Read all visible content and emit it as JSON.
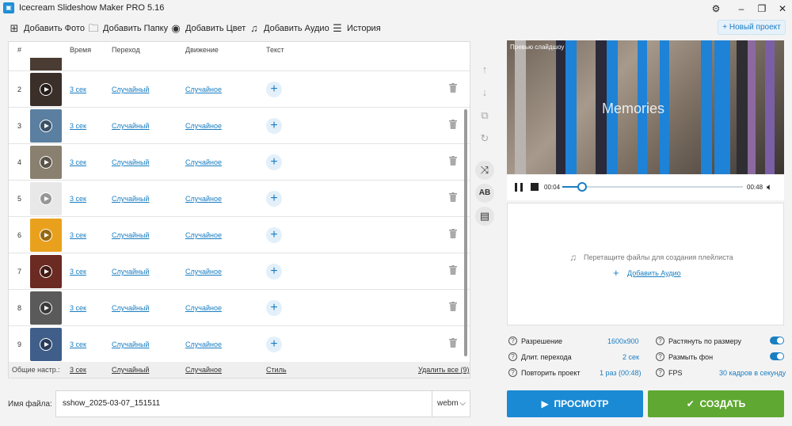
{
  "window": {
    "title": "Icecream Slideshow Maker PRO 5.16"
  },
  "toolbar": {
    "add_photo": "Добавить Фото",
    "add_folder": "Добавить Папку",
    "add_color": "Добавить Цвет",
    "add_audio": "Добавить Аудио",
    "history": "История",
    "new_project": "+ Новый проект"
  },
  "list": {
    "headers": {
      "num": "#",
      "time": "Время",
      "transition": "Переход",
      "motion": "Движение",
      "text": "Текст"
    },
    "rows": [
      {
        "num": "2",
        "time": "3 сек",
        "transition": "Случайный",
        "motion": "Случайное",
        "thumb_color": "#3b2f2a"
      },
      {
        "num": "3",
        "time": "3 сек",
        "transition": "Случайный",
        "motion": "Случайное",
        "thumb_color": "#5b7fa0"
      },
      {
        "num": "4",
        "time": "3 сек",
        "transition": "Случайный",
        "motion": "Случайное",
        "thumb_color": "#8a8070"
      },
      {
        "num": "5",
        "time": "3 сек",
        "transition": "Случайный",
        "motion": "Случайное",
        "thumb_color": "#e8e8e8"
      },
      {
        "num": "6",
        "time": "3 сек",
        "transition": "Случайный",
        "motion": "Случайное",
        "thumb_color": "#e9a11d"
      },
      {
        "num": "7",
        "time": "3 сек",
        "transition": "Случайный",
        "motion": "Случайное",
        "thumb_color": "#6b2a22"
      },
      {
        "num": "8",
        "time": "3 сек",
        "transition": "Случайный",
        "motion": "Случайное",
        "thumb_color": "#5a5a5a"
      },
      {
        "num": "9",
        "time": "3 сек",
        "transition": "Случайный",
        "motion": "Случайное",
        "thumb_color": "#3f5f8a"
      }
    ],
    "footer": {
      "label": "Общие настр.:",
      "time": "3 сек",
      "transition": "Случайный",
      "motion": "Случайное",
      "style": "Стиль",
      "delete_all": "Удалить все (9)"
    }
  },
  "filename": {
    "label": "Имя файла:",
    "value": "sshow_2025-03-07_151511",
    "format": "webm"
  },
  "preview": {
    "label": "Превью слайдшоу",
    "caption": "Memories",
    "current_time": "00:04",
    "total_time": "00:48",
    "progress": 0.11
  },
  "audio": {
    "drop_hint": "Перетащите файлы для создания плейлиста",
    "add_audio": "Добавить Аудио"
  },
  "settings": {
    "resolution_label": "Разрешение",
    "resolution_value": "1600x900",
    "transition_len_label": "Длит. перехода",
    "transition_len_value": "2 сек",
    "repeat_label": "Повторить проект",
    "repeat_value": "1 раз (00:48)",
    "stretch_label": "Растянуть по размеру",
    "stretch_on": true,
    "blur_label": "Размыть фон",
    "blur_on": true,
    "fps_label": "FPS",
    "fps_value": "30 кадров в секунду"
  },
  "actions": {
    "preview": "ПРОСМОТР",
    "create": "СОЗДАТЬ"
  },
  "colors": {
    "accent": "#1a7ec2",
    "preview_btn": "#1a8ad4",
    "create_btn": "#5fa832"
  }
}
